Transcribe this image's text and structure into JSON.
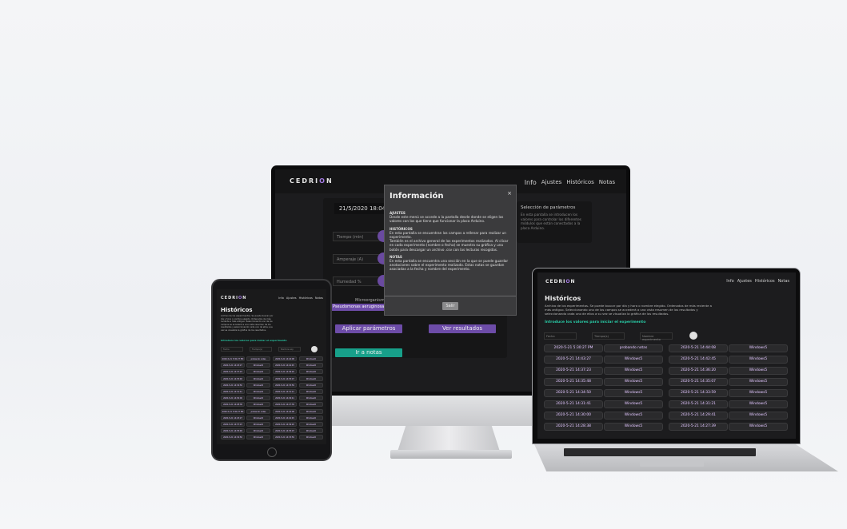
{
  "monitor": {
    "logo": "CEDRI",
    "logo_o": "O",
    "logo_tail": "N",
    "nav": [
      "Info",
      "Ajustes",
      "Históricos",
      "Notas"
    ],
    "date": "21/5/2020 18:04",
    "fields": [
      "Tiempo (min)",
      "Amperaje (A)",
      "Humedad %"
    ],
    "micro_label": "Microorganismo",
    "micro_value": "Pseudomonas aeruginosa",
    "apply_button": "Aplicar parámetros",
    "results_button": "Ver resultados",
    "notes_button": "Ir a notas",
    "side_title": "Selección de parámetros",
    "side_text": "En esta pantalla se introducen los valores para controlar los diferentes módulos que están conectados a la placa Arduino.",
    "modal": {
      "title": "Información",
      "close": "×",
      "s1_h": "AJUSTES",
      "s1_t": "Desde este menú se accede a la pantalla desde donde se eligen los valores con los que tiene que funcionar la placa Arduino.",
      "s2_h": "HISTÓRICOS",
      "s2_t1": "En esta pantalla se encuentran los campos a rellenar para realizar un experimento.",
      "s2_t2": "También es el archivo general de los experimentos realizados. Al clicar en cada experimento (nombre o fecha) se muestra su gráfica y una botón para descargar un archivo .csv con las lecturas recogidas.",
      "s3_h": "NOTAS",
      "s3_t": "En esta pantalla se encuentra una sección en la que se puede guardar anotaciones sobre el experimento realizado. Estas notas se guardan asociadas a la fecha y nombre del experimento.",
      "exit": "Salir"
    }
  },
  "tablet": {
    "logo": "CEDRI",
    "logo_o": "O",
    "logo_tail": "N",
    "nav": [
      "Info",
      "Ajustes",
      "Históricos",
      "Notas"
    ],
    "title": "Históricos",
    "desc": "Archivo de los experimentos. Se puede buscar por día y hora o nombre elegido. Ordenados de más reciente a más antiguo. Seleccionando uno de los campos se accederá a una vista resumen de los resultados y seleccionando cada uno de ellos a su vez se visualiza la gráfica de los resultados.",
    "link": "Introduce los valores para iniciar el experimento",
    "inputs": [
      "Fecha",
      "Tiempo(s)",
      "Nombre exp"
    ]
  },
  "laptop": {
    "logo": "CEDRI",
    "logo_o": "O",
    "logo_tail": "N",
    "nav": [
      "Info",
      "Ajustes",
      "Históricos",
      "Notas"
    ],
    "title": "Históricos",
    "desc": "Archivo de los experimentos. Se puede buscar por día y hora o nombre elegido. Ordenados de más reciente a más antiguo. Seleccionando uno de los campos se accederá a una vista resumen de los resultados y seleccionando cada uno de ellos a su vez se visualiza la gráfica de los resultados.",
    "link": "Introduce los valores para iniciar el experimento",
    "inputs": [
      "Fecha",
      "Tiempo(s)",
      "Nombre experimento"
    ],
    "rows": [
      [
        "2020-5-21 5:30:27 PM",
        "probando notas",
        "2020-5-21 14:44:08",
        "Windows5"
      ],
      [
        "2020-5-21 14:43:27",
        "Windows5",
        "2020-5-21 14:42:45",
        "Windows5"
      ],
      [
        "2020-5-21 14:37:23",
        "Windows5",
        "2020-5-21 14:36:20",
        "Windows5"
      ],
      [
        "2020-5-21 14:35:48",
        "Windows5",
        "2020-5-21 14:35:07",
        "Windows5"
      ],
      [
        "2020-5-21 14:34:50",
        "Windows5",
        "2020-5-21 14:33:59",
        "Windows5"
      ],
      [
        "2020-5-21 14:31:41",
        "Windows5",
        "2020-5-21 14:31:21",
        "Windows5"
      ],
      [
        "2020-5-21 14:30:00",
        "Windows5",
        "2020-5-21 14:29:41",
        "Windows5"
      ],
      [
        "2020-5-21 14:28:38",
        "Windows5",
        "2020-5-21 14:27:39",
        "Windows5"
      ]
    ]
  },
  "colors": {
    "accent": "#6d4ca8",
    "teal": "#17a08a",
    "link": "#28c9a5",
    "cell_text": "#e2c6ff"
  }
}
